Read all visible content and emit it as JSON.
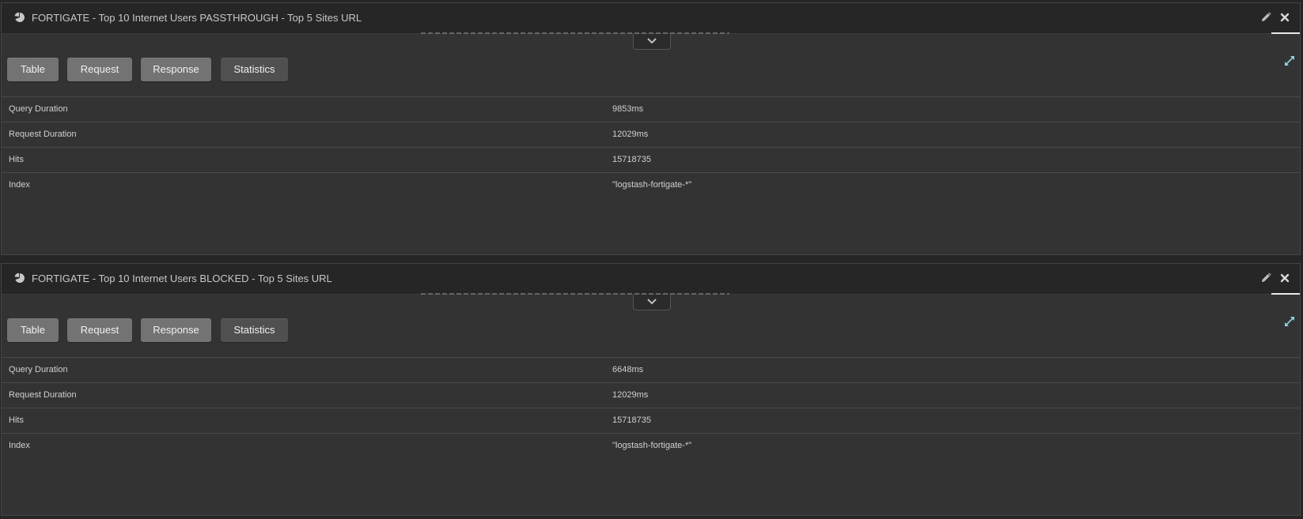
{
  "panels": [
    {
      "title": "FORTIGATE - Top 10 Internet Users PASSTHROUGH - Top 5 Sites URL",
      "tabs": [
        "Table",
        "Request",
        "Response",
        "Statistics"
      ],
      "active_tab": "Statistics",
      "stats": [
        {
          "key": "Query Duration",
          "value": "9853ms"
        },
        {
          "key": "Request Duration",
          "value": "12029ms"
        },
        {
          "key": "Hits",
          "value": "15718735"
        },
        {
          "key": "Index",
          "value": "\"logstash-fortigate-*\""
        }
      ]
    },
    {
      "title": "FORTIGATE - Top 10 Internet Users BLOCKED - Top 5 Sites URL",
      "tabs": [
        "Table",
        "Request",
        "Response",
        "Statistics"
      ],
      "active_tab": "Statistics",
      "stats": [
        {
          "key": "Query Duration",
          "value": "6648ms"
        },
        {
          "key": "Request Duration",
          "value": "12029ms"
        },
        {
          "key": "Hits",
          "value": "15718735"
        },
        {
          "key": "Index",
          "value": "\"logstash-fortigate-*\""
        }
      ]
    }
  ],
  "icons": {
    "header": "pie-chart-icon",
    "edit": "pencil-icon",
    "close": "close-icon",
    "collapse": "chevron-down-icon",
    "expand": "expand-arrows-icon"
  },
  "colors": {
    "background": "#262626",
    "panel": "#333333",
    "header": "#262626",
    "button": "#737373",
    "button_active": "#505050",
    "text": "#d0d0d0",
    "expand_icon": "#8fd3e8"
  }
}
